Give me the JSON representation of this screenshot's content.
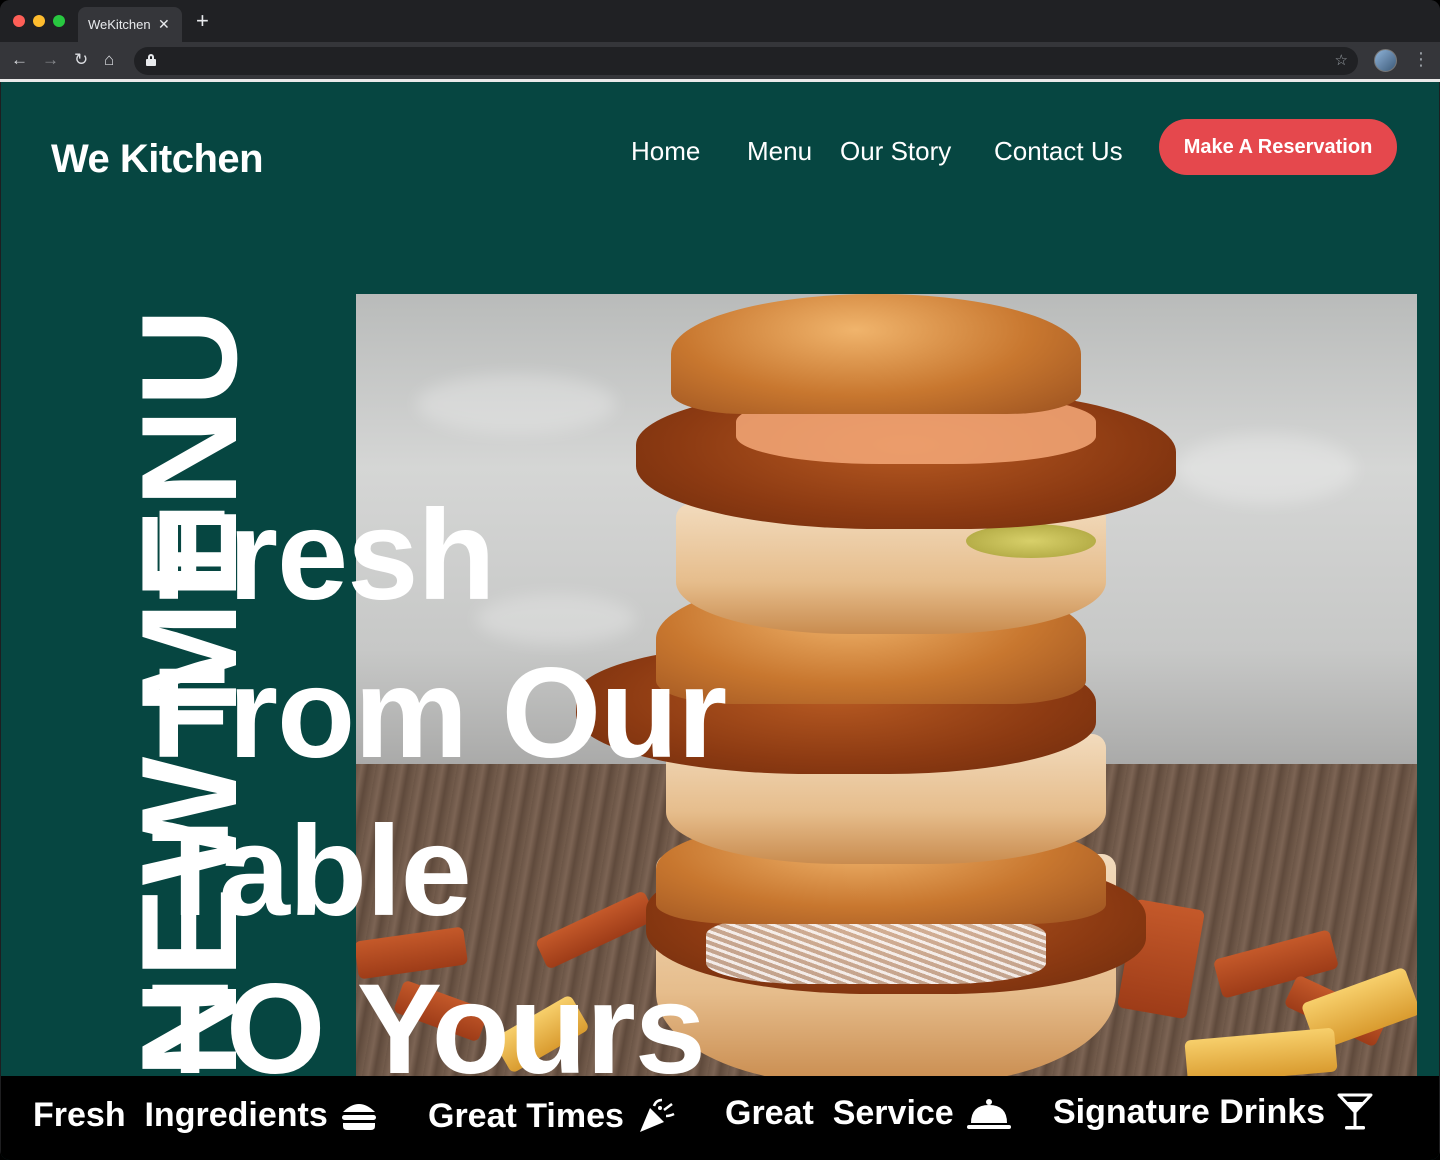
{
  "browser": {
    "tab_title": "WeKitchen",
    "tab_close": "✕",
    "new_tab": "+"
  },
  "site": {
    "brand": "We Kitchen",
    "nav": [
      "Home",
      "Menu",
      "Our Story",
      "Contact Us"
    ],
    "cta": "Make A Reservation"
  },
  "hero": {
    "vertical_tag": "NEW MENU",
    "headline_lines": [
      "Fresh",
      "From Our",
      "Table",
      "TO Yours"
    ],
    "image": "stacked-chicken-burgers-photo"
  },
  "features": [
    {
      "label": "Fresh  Ingredients",
      "icon": "burger-icon"
    },
    {
      "label": "Great Times",
      "icon": "party-popper-icon"
    },
    {
      "label": "Great  Service",
      "icon": "cloche-icon"
    },
    {
      "label": "Signature Drinks",
      "icon": "cocktail-icon"
    }
  ],
  "colors": {
    "page_bg": "#064641",
    "cta_bg": "#e5484d",
    "feature_bar_bg": "#000000",
    "text": "#ffffff"
  }
}
